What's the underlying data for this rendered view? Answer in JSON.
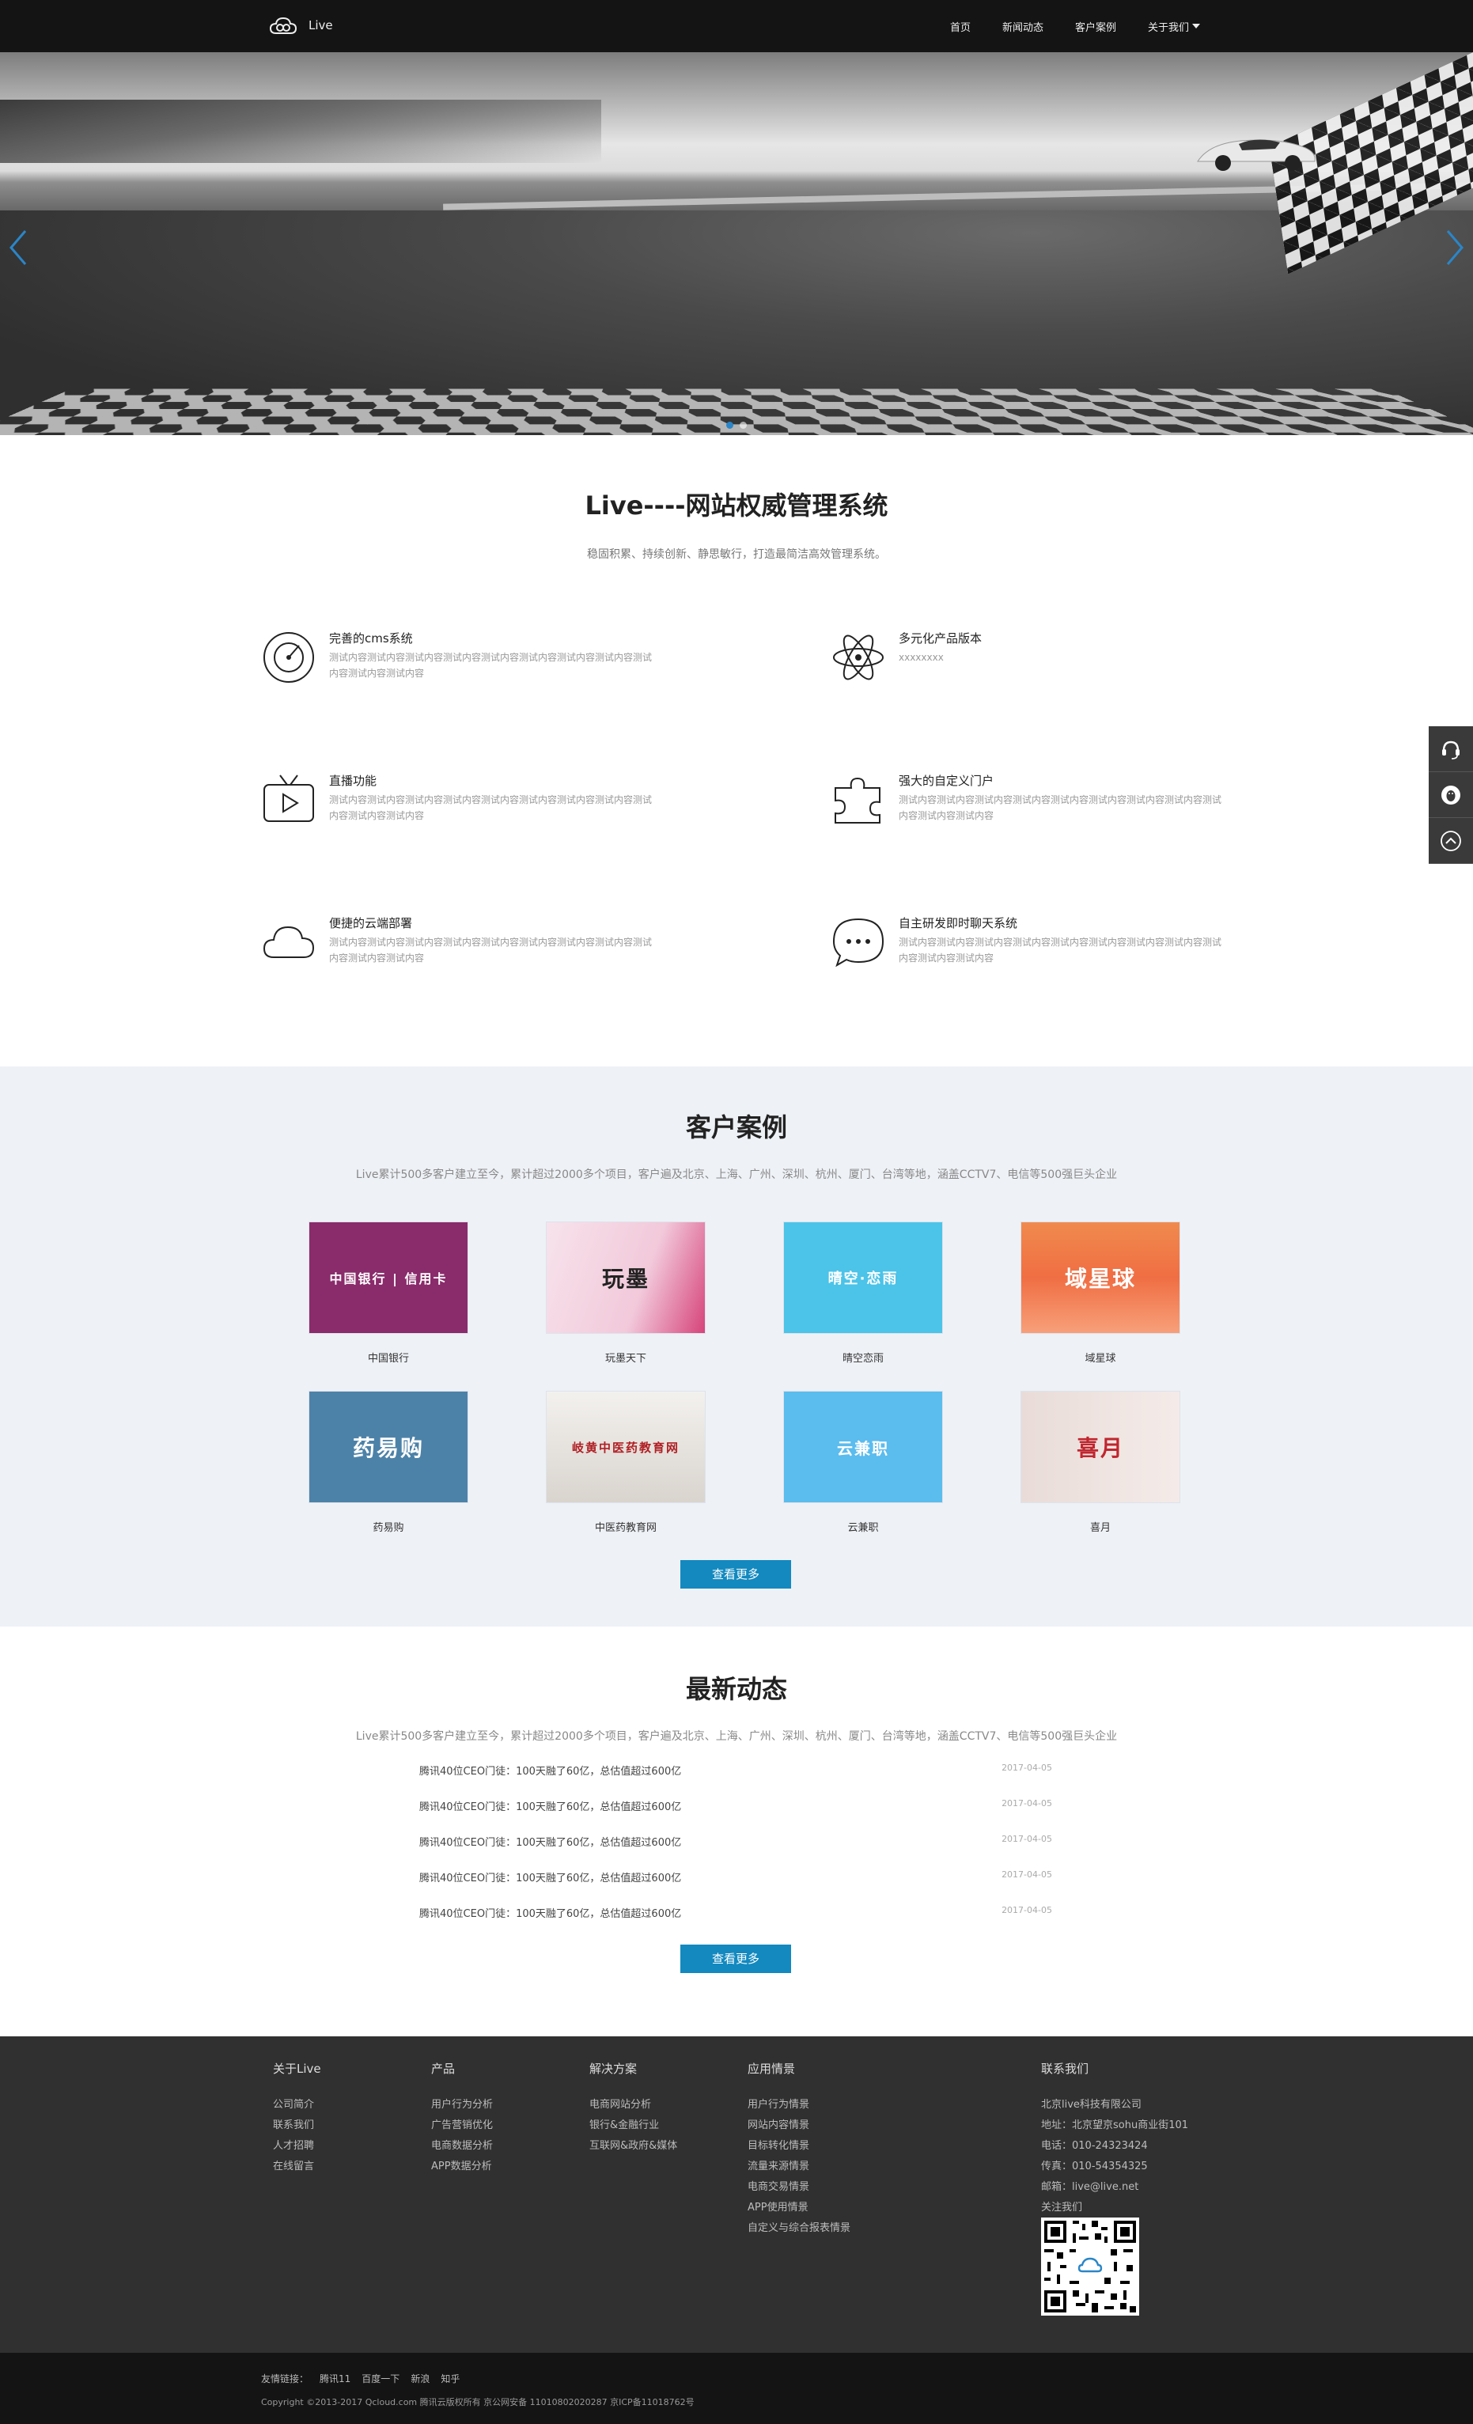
{
  "nav": {
    "brand": "Live",
    "items": [
      {
        "label": "首页"
      },
      {
        "label": "新闻动态"
      },
      {
        "label": "客户案例"
      },
      {
        "label": "关于我们"
      }
    ]
  },
  "intro": {
    "title": "Live----网站权威管理系统",
    "subtitle": "稳固积累、持续创新、静思敏行，打造最简洁高效管理系统。",
    "features": [
      {
        "title": "完善的cms系统",
        "icon": "radar-icon",
        "desc": "测试内容测试内容测试内容测试内容测试内容测试内容测试内容测试内容测试内容测试内容测试内容"
      },
      {
        "title": "多元化产品版本",
        "icon": "atom-icon",
        "desc": "xxxxxxxx"
      },
      {
        "title": "直播功能",
        "icon": "tv-play-icon",
        "desc": "测试内容测试内容测试内容测试内容测试内容测试内容测试内容测试内容测试内容测试内容测试内容"
      },
      {
        "title": "强大的自定义门户",
        "icon": "puzzle-icon",
        "desc": "测试内容测试内容测试内容测试内容测试内容测试内容测试内容测试内容测试内容测试内容测试内容"
      },
      {
        "title": "便捷的云端部署",
        "icon": "cloud-icon",
        "desc": "测试内容测试内容测试内容测试内容测试内容测试内容测试内容测试内容测试内容测试内容测试内容"
      },
      {
        "title": "自主研发即时聊天系统",
        "icon": "chat-bubble-icon",
        "desc": "测试内容测试内容测试内容测试内容测试内容测试内容测试内容测试内容测试内容测试内容测试内容"
      }
    ]
  },
  "cases": {
    "title": "客户案例",
    "subtitle": "Live累计500多客户建立至今，累计超过2000多个项目，客户遍及北京、上海、广州、深圳、杭州、厦门、台湾等地，涵盖CCTV7、电信等500强巨头企业",
    "items": [
      {
        "name": "中国银行",
        "thumb_text": "中国银行 | 信用卡",
        "color": "#8a2b6b"
      },
      {
        "name": "玩墨天下",
        "thumb_text": "玩墨",
        "color": "#f2c9da"
      },
      {
        "name": "晴空恋雨",
        "thumb_text": "晴空·恋雨",
        "color": "#4cc3e8"
      },
      {
        "name": "域星球",
        "thumb_text": "域星球",
        "color": "#f06e43"
      },
      {
        "name": "药易购",
        "thumb_text": "药易购",
        "color": "#4d82a8"
      },
      {
        "name": "中医药教育网",
        "thumb_text": "岐黄中医药教育网",
        "color": "#e9e6e2"
      },
      {
        "name": "云兼职",
        "thumb_text": "云兼职",
        "color": "#5bbcee"
      },
      {
        "name": "喜月",
        "thumb_text": "喜月",
        "color": "#efe3e1"
      }
    ],
    "more": "查看更多"
  },
  "news": {
    "title": "最新动态",
    "subtitle": "Live累计500多客户建立至今，累计超过2000多个项目，客户遍及北京、上海、广州、深圳、杭州、厦门、台湾等地，涵盖CCTV7、电信等500强巨头企业",
    "items": [
      {
        "title": "腾讯40位CEO门徒：100天融了60亿，总估值超过600亿",
        "date": "2017-04-05"
      },
      {
        "title": "腾讯40位CEO门徒：100天融了60亿，总估值超过600亿",
        "date": "2017-04-05"
      },
      {
        "title": "腾讯40位CEO门徒：100天融了60亿，总估值超过600亿",
        "date": "2017-04-05"
      },
      {
        "title": "腾讯40位CEO门徒：100天融了60亿，总估值超过600亿",
        "date": "2017-04-05"
      },
      {
        "title": "腾讯40位CEO门徒：100天融了60亿，总估值超过600亿",
        "date": "2017-04-05"
      }
    ],
    "more": "查看更多"
  },
  "footer": {
    "cols": [
      {
        "head": "关于Live",
        "items": [
          "公司简介",
          "联系我们",
          "人才招聘",
          "在线留言"
        ]
      },
      {
        "head": "产品",
        "items": [
          "用户行为分析",
          "广告营销优化",
          "电商数据分析",
          "APP数据分析"
        ]
      },
      {
        "head": "解决方案",
        "items": [
          "电商网站分析",
          "银行&金融行业",
          "互联网&政府&媒体"
        ]
      },
      {
        "head": "应用情景",
        "items": [
          "用户行为情景",
          "网站内容情景",
          "目标转化情景",
          "流量来源情景",
          "电商交易情景",
          "APP使用情景",
          "自定义与综合报表情景"
        ]
      }
    ],
    "contact": {
      "head": "联系我们",
      "items": [
        "北京live科技有限公司",
        "地址：北京望京sohu商业街101",
        "电话：010-24323424",
        "传真：010-54354325",
        "邮箱：live@live.net",
        "关注我们"
      ]
    }
  },
  "bottom": {
    "links_label": "友情链接：",
    "links": [
      "腾讯11",
      "百度一下",
      "新浪",
      "知乎"
    ],
    "copyright": "Copyright ©2013-2017 Qcloud.com 腾讯云版权所有 京公网安备 11010802020287 京ICP备11018762号"
  },
  "side": {
    "buttons": [
      "headset-icon",
      "qq-icon",
      "back-to-top-icon"
    ]
  }
}
